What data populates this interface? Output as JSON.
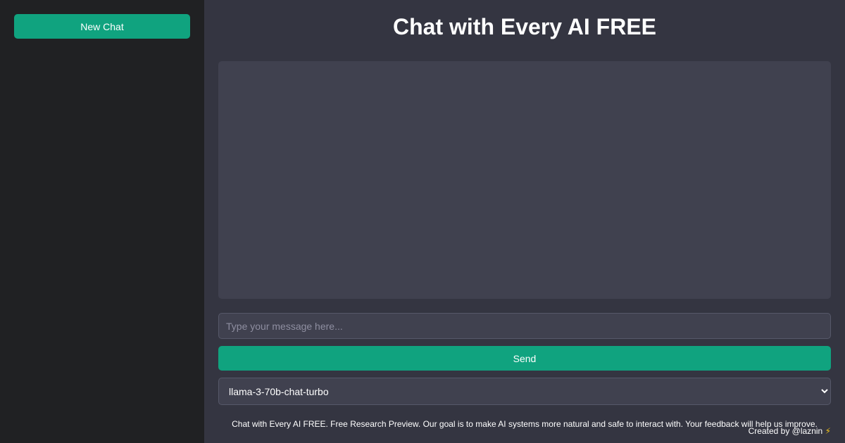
{
  "sidebar": {
    "new_chat_label": "New Chat"
  },
  "header": {
    "title": "Chat with Every AI FREE"
  },
  "composer": {
    "placeholder": "Type your message here...",
    "value": "",
    "send_label": "Send"
  },
  "model_selector": {
    "selected": "llama-3-70b-chat-turbo",
    "options": [
      "llama-3-70b-chat-turbo"
    ]
  },
  "footer": {
    "note": "Chat with Every AI FREE. Free Research Preview. Our goal is to make AI systems more natural and safe to interact with. Your feedback will help us improve.",
    "credit": "Created by @laznin",
    "credit_icon": "⚡"
  },
  "colors": {
    "accent": "#10a37f",
    "sidebar_bg": "#202123",
    "main_bg": "#343541",
    "panel_bg": "#40414f"
  },
  "icons": [
    "bolt-icon",
    "chevron-down-icon"
  ]
}
